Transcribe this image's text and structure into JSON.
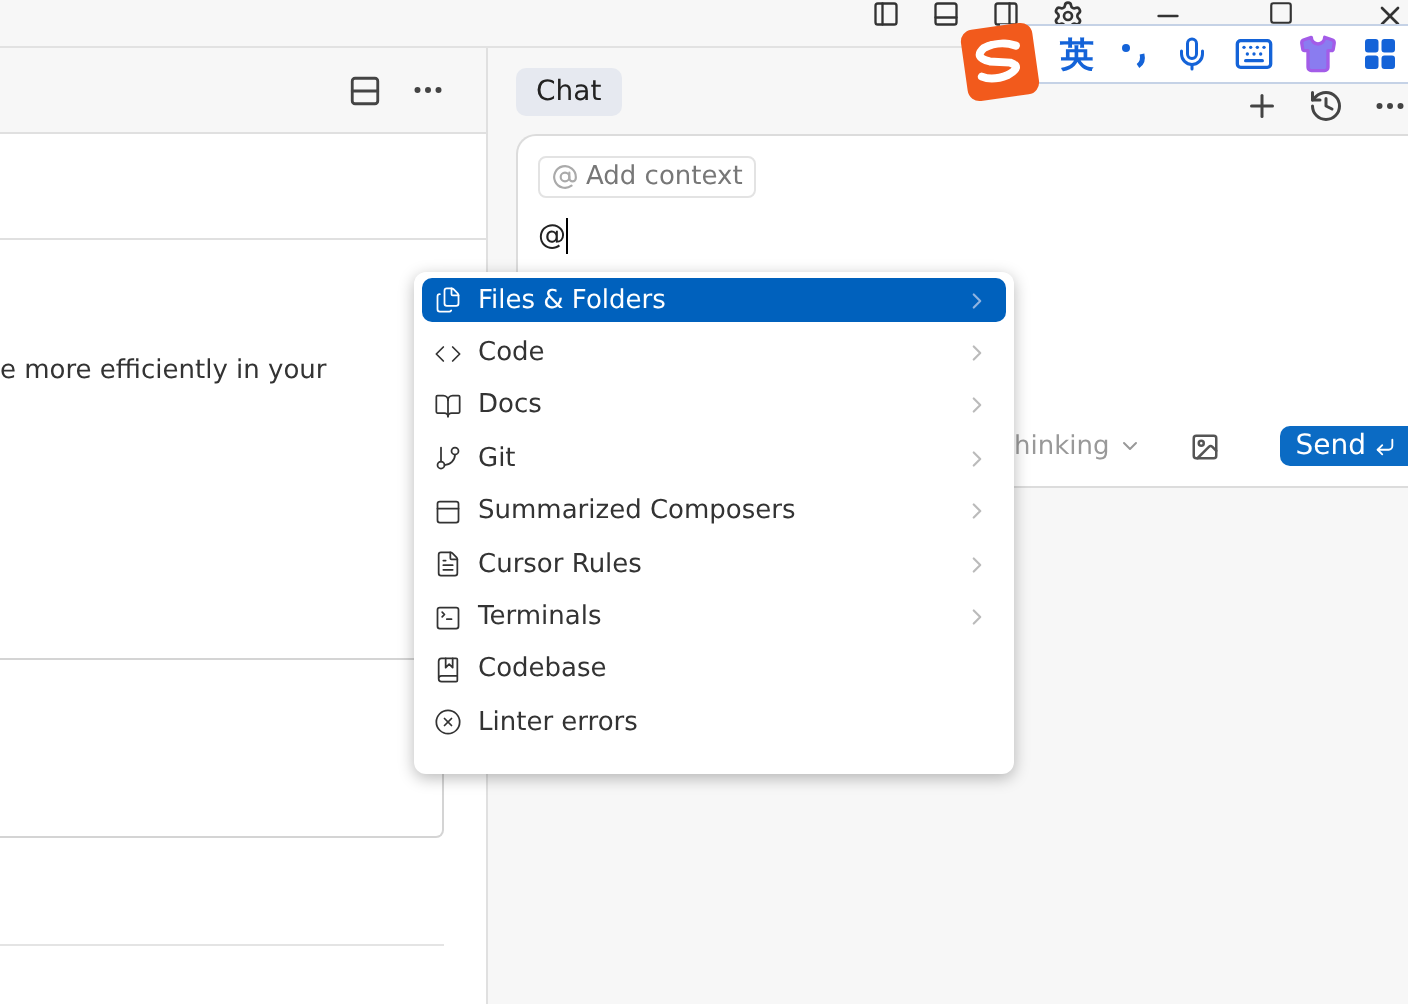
{
  "editor": {
    "paragraph": "e more efficiently in your"
  },
  "chat": {
    "tabs": [
      {
        "label": "Chat",
        "selected": true
      }
    ],
    "context_chip": "Add context",
    "input_value": "@",
    "model_label": "hinking",
    "send_label": "Send"
  },
  "mention_menu": {
    "items": [
      {
        "label": "Files & Folders",
        "kind": "files",
        "has_submenu": true,
        "selected": true
      },
      {
        "label": "Code",
        "kind": "code",
        "has_submenu": true,
        "selected": false
      },
      {
        "label": "Docs",
        "kind": "docs",
        "has_submenu": true,
        "selected": false
      },
      {
        "label": "Git",
        "kind": "git",
        "has_submenu": true,
        "selected": false
      },
      {
        "label": "Summarized Composers",
        "kind": "composer",
        "has_submenu": true,
        "selected": false
      },
      {
        "label": "Cursor Rules",
        "kind": "rules",
        "has_submenu": true,
        "selected": false
      },
      {
        "label": "Terminals",
        "kind": "terminal",
        "has_submenu": true,
        "selected": false
      },
      {
        "label": "Codebase",
        "kind": "codebase",
        "has_submenu": false,
        "selected": false
      },
      {
        "label": "Linter errors",
        "kind": "linter",
        "has_submenu": false,
        "selected": false
      }
    ]
  },
  "ime_bar": {
    "language": "英"
  }
}
